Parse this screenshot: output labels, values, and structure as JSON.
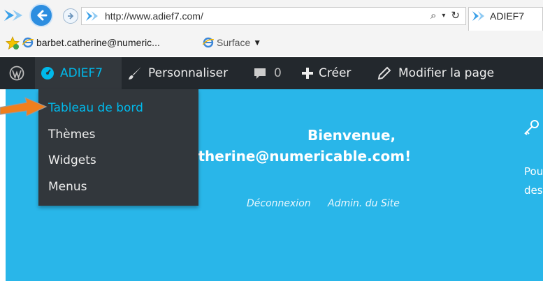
{
  "browser": {
    "address": "http://www.adief7.com/",
    "tab_title": "ADIEF7",
    "favorites": {
      "item1": "barbet.catherine@numeric...",
      "item2": "Surface"
    }
  },
  "adminbar": {
    "site_name": "ADIEF7",
    "customize": "Personnaliser",
    "comments_count": "0",
    "new": "Créer",
    "edit_page": "Modifier la page"
  },
  "dropdown": {
    "items": [
      "Tableau de bord",
      "Thèmes",
      "Widgets",
      "Menus"
    ]
  },
  "content": {
    "welcome_line1": "Bienvenue,",
    "welcome_line2": "atherine@numericable.com!",
    "logout": "Déconnexion",
    "admin": "Admin. du Site",
    "side_line1": "Pou",
    "side_line2": "des"
  },
  "colors": {
    "adminbar": "#23282d",
    "accent": "#00b9eb",
    "page_bg": "#29b6e9",
    "arrow": "#f07f1d"
  }
}
